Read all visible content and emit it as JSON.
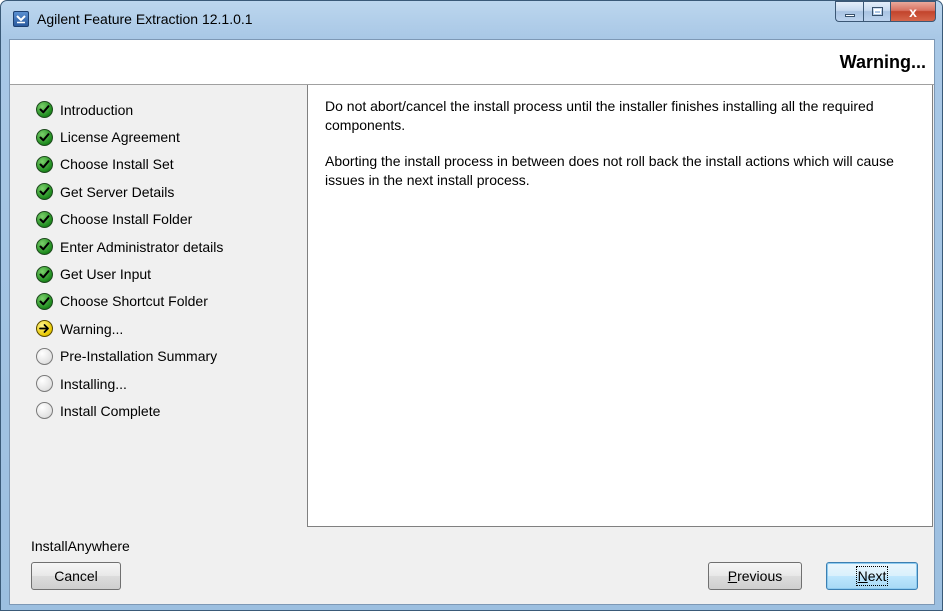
{
  "window": {
    "title": "Agilent Feature Extraction 12.1.0.1",
    "app_icon": "installer-app-icon",
    "caption_buttons": {
      "minimize": "minimize-icon",
      "maximize": "maximize-icon",
      "close": "x"
    }
  },
  "header": {
    "title": "Warning..."
  },
  "steps": [
    {
      "label": "Introduction",
      "status": "done"
    },
    {
      "label": "License Agreement",
      "status": "done"
    },
    {
      "label": "Choose Install Set",
      "status": "done"
    },
    {
      "label": "Get Server Details",
      "status": "done"
    },
    {
      "label": "Choose Install Folder",
      "status": "done"
    },
    {
      "label": "Enter Administrator details",
      "status": "done"
    },
    {
      "label": "Get User Input",
      "status": "done"
    },
    {
      "label": "Choose Shortcut Folder",
      "status": "done"
    },
    {
      "label": "Warning...",
      "status": "current"
    },
    {
      "label": "Pre-Installation Summary",
      "status": "pending"
    },
    {
      "label": "Installing...",
      "status": "pending"
    },
    {
      "label": "Install Complete",
      "status": "pending"
    }
  ],
  "content": {
    "paragraphs": [
      "Do not abort/cancel the install process until the installer finishes installing all the required components.",
      "Aborting the install process in between does not roll back the install actions which will cause issues in the next install process."
    ]
  },
  "footer": {
    "brand": "InstallAnywhere",
    "cancel": "Cancel",
    "previous": {
      "first": "P",
      "rest": "revious"
    },
    "next": {
      "first": "N",
      "rest": "ext"
    }
  },
  "colors": {
    "done": "#1d8a1d",
    "current": "#e8c800",
    "pending": "#e2e2e2",
    "close_button": "#c2442c"
  }
}
